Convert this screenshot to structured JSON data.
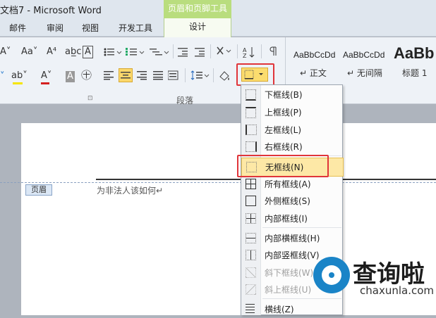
{
  "window": {
    "title": "文档7 - Microsoft Word"
  },
  "context_tab": {
    "group": "页眉和页脚工具",
    "tab": "设计"
  },
  "tabs": [
    "邮件",
    "审阅",
    "视图",
    "开发工具"
  ],
  "ribbon": {
    "row1_icons": [
      "A˅",
      "Aa˅",
      "A⁴",
      "ab̲c",
      "A"
    ],
    "row2_icons": [
      "ab˅",
      "A˅",
      "A",
      "㊉"
    ],
    "group_label": "段落",
    "launcher": "⊡",
    "styles": [
      {
        "sample": "AaBbCcDd",
        "name": "↵ 正文"
      },
      {
        "sample": "AaBbCcDd",
        "name": "↵ 无间隔"
      },
      {
        "sample": "AaBb",
        "name": "标题 1"
      }
    ]
  },
  "menu": {
    "items": [
      {
        "label": "下框线(B)",
        "icon": "bottom-border-icon",
        "disabled": false
      },
      {
        "label": "上框线(P)",
        "icon": "top-border-icon",
        "disabled": false
      },
      {
        "label": "左框线(L)",
        "icon": "left-border-icon",
        "disabled": false
      },
      {
        "label": "右框线(R)",
        "icon": "right-border-icon",
        "disabled": false
      },
      {
        "label": "无框线(N)",
        "icon": "no-border-icon",
        "disabled": false,
        "highlighted": true
      },
      {
        "label": "所有框线(A)",
        "icon": "all-borders-icon",
        "disabled": false
      },
      {
        "label": "外侧框线(S)",
        "icon": "outside-borders-icon",
        "disabled": false
      },
      {
        "label": "内部框线(I)",
        "icon": "inside-borders-icon",
        "disabled": false
      },
      {
        "label": "内部横框线(H)",
        "icon": "inside-horizontal-border-icon",
        "disabled": false
      },
      {
        "label": "内部竖框线(V)",
        "icon": "inside-vertical-border-icon",
        "disabled": false
      },
      {
        "label": "斜下框线(W)",
        "icon": "diagonal-down-border-icon",
        "disabled": true
      },
      {
        "label": "斜上框线(U)",
        "icon": "diagonal-up-border-icon",
        "disabled": true
      },
      {
        "label": "横线(Z)",
        "icon": "horizontal-line-icon",
        "disabled": false
      }
    ]
  },
  "document": {
    "header_tag": "页眉",
    "header_text": "为非法人该如何↵"
  },
  "watermark": {
    "brand": "查询啦",
    "url": "chaxunla.com"
  },
  "colors": {
    "accent_red": "#e0353a",
    "highlight": "#fde8a6",
    "context_green": "#b9dd7e",
    "logo_blue": "#1a84c7"
  }
}
